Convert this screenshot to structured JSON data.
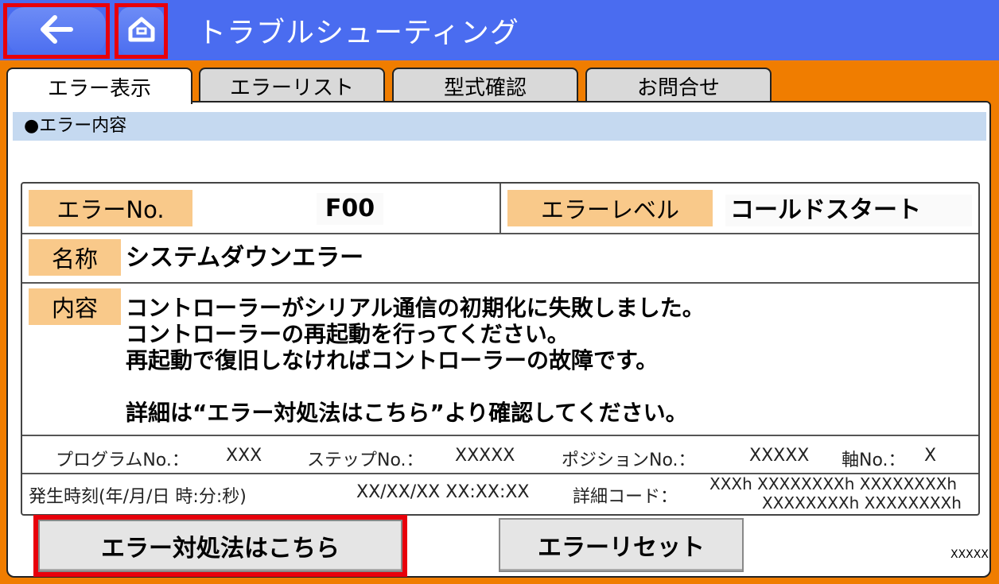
{
  "header": {
    "title": "トラブルシューティング",
    "accent_color": "#4a6cf0",
    "highlight_color": "#e8000b"
  },
  "tabs": [
    {
      "label": "エラー表示",
      "active": true
    },
    {
      "label": "エラーリスト",
      "active": false
    },
    {
      "label": "型式確認",
      "active": false
    },
    {
      "label": "お問合せ",
      "active": false
    }
  ],
  "section": {
    "title": "●エラー内容"
  },
  "error": {
    "no_label": "エラーNo.",
    "no_value": "F00",
    "level_label": "エラーレベル",
    "level_value": "コールドスタート",
    "name_label": "名称",
    "name_value": "システムダウンエラー",
    "content_label": "内容",
    "content_lines": [
      "コントローラーがシリアル通信の初期化に失敗しました。",
      "コントローラーの再起動を行ってください。",
      "再起動で復旧しなければコントローラーの故障です。",
      "",
      "詳細は“エラー対処法はこちら”より確認してください。"
    ]
  },
  "program": {
    "program_label": "プログラムNo.：",
    "program_value": "XXX",
    "step_label": "ステップNo.：",
    "step_value": "XXXXX",
    "position_label": "ポジションNo.：",
    "position_value": "XXXXX",
    "axis_label": "軸No.：",
    "axis_value": "X"
  },
  "occurrence": {
    "time_label": "発生時刻(年/月/日 時:分:秒)",
    "time_value": "XX/XX/XX XX:XX:XX",
    "detail_label": "詳細コード：",
    "detail_line1": "XXXh XXXXXXXXh XXXXXXXXh",
    "detail_line2": "XXXXXXXXh XXXXXXXXh"
  },
  "buttons": {
    "remedy_label": "エラー対処法はこちら",
    "reset_label": "エラーリセット"
  },
  "footer": {
    "code": "XXXXX"
  },
  "icons": {
    "back": "arrow-left-icon",
    "home": "home-icon"
  }
}
